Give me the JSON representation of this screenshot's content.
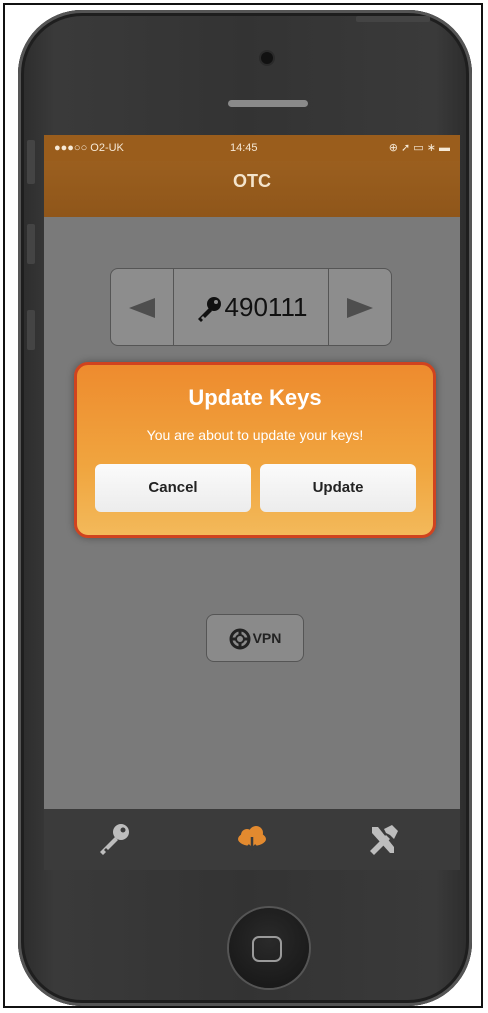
{
  "status_bar": {
    "carrier": "●●●○○ O2-UK",
    "time": "14:45",
    "indicators": "⊕ ➚ ▭ ∗ ▬"
  },
  "navbar": {
    "title": "OTC"
  },
  "key_stepper": {
    "value": "490111",
    "prev_icon": "arrow-left-icon",
    "next_icon": "arrow-right-icon",
    "key_icon": "key-icon"
  },
  "vpn_button": {
    "label": "VPN",
    "icon": "lifebuoy-icon"
  },
  "alert": {
    "title": "Update Keys",
    "message": "You are about to update your keys!",
    "cancel_label": "Cancel",
    "update_label": "Update"
  },
  "tabbar": {
    "items": [
      {
        "icon": "key-icon",
        "active": false
      },
      {
        "icon": "cloud-download-icon",
        "active": true
      },
      {
        "icon": "tools-icon",
        "active": false
      }
    ]
  },
  "colors": {
    "nav_brown": "#9a5d1c",
    "alert_orange": "#f0a53f",
    "alert_border": "#d0431f",
    "active_tab": "#e38a2f"
  }
}
